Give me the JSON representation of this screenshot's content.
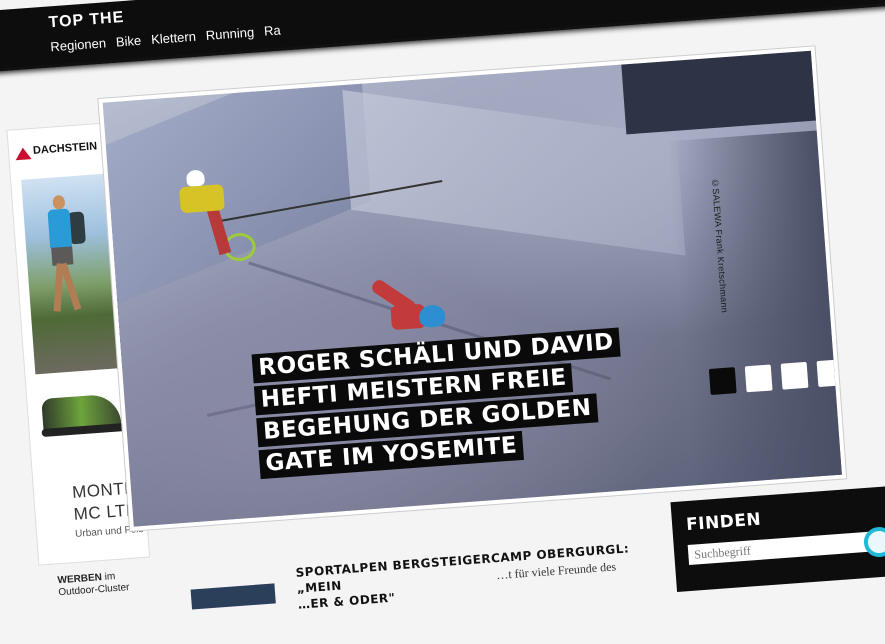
{
  "nav": {
    "brand": "TOP THE",
    "links": [
      "Regionen",
      "Bike",
      "Klettern",
      "Running",
      "Ra"
    ]
  },
  "ad": {
    "logo": "DACHSTEIN",
    "product_line1": "MONTE",
    "product_line2": "MC LTH",
    "product_sub": "Urban und Fels"
  },
  "werben": {
    "bold": "WERBEN",
    "rest1": "im",
    "rest2": "Outdoor-Cluster"
  },
  "hero": {
    "headline_lines": [
      "ROGER SCHÄLI UND DAVID",
      "HEFTI MEISTERN FREIE",
      "BEGEHUNG DER GOLDEN",
      "GATE IM YOSEMITE"
    ],
    "credit": "©SALEWA Frank Kretschmann",
    "slides": 4,
    "active_slide": 1
  },
  "teaser": {
    "title_line1": "SPORTALPEN BERGSTEIGERCAMP OBERGURGL: „MEIN",
    "title_line2": "…ER & ODER\"",
    "text": "…t für viele Freunde des"
  },
  "search": {
    "label": "FINDEN",
    "placeholder": "Suchbegriff"
  },
  "colors": {
    "nav_bg": "#0d0d0d",
    "accent": "#22b8d8",
    "brand_red": "#c8102e"
  }
}
